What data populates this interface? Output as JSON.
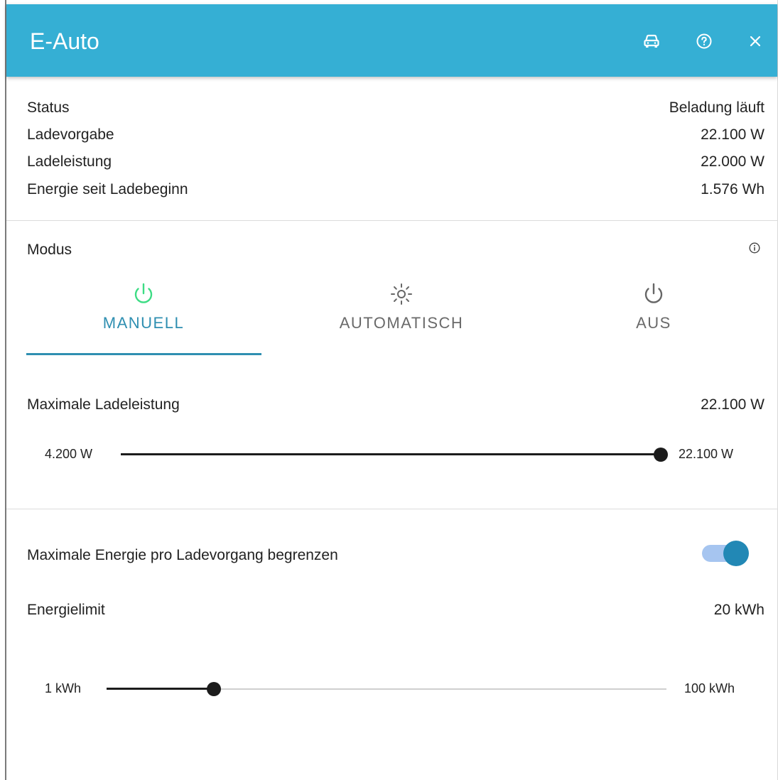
{
  "dialog": {
    "title": "E-Auto",
    "header_icons": [
      "car-icon",
      "help-circle-icon",
      "close-icon"
    ]
  },
  "status_rows": [
    {
      "label": "Status",
      "value": "Beladung läuft"
    },
    {
      "label": "Ladevorgabe",
      "value": "22.100 W"
    },
    {
      "label": "Ladeleistung",
      "value": "22.000 W"
    },
    {
      "label": "Energie seit Ladebeginn",
      "value": "1.576 Wh"
    }
  ],
  "mode": {
    "label": "Modus",
    "tabs": [
      {
        "label": "MANUELL",
        "icon": "power-icon",
        "active": true
      },
      {
        "label": "AUTOMATISCH",
        "icon": "sun-icon",
        "active": false
      },
      {
        "label": "AUS",
        "icon": "power-off-icon",
        "active": false
      }
    ]
  },
  "max_power": {
    "label": "Maximale Ladeleistung",
    "value": "22.100 W",
    "min_label": "4.200 W",
    "max_label": "22.100 W",
    "min": 4200,
    "max": 22100,
    "current": 22100
  },
  "energy_limit": {
    "toggle_label": "Maximale Energie pro Ladevorgang begrenzen",
    "toggle_on": true,
    "label": "Energielimit",
    "value": "20 kWh",
    "min_label": "1 kWh",
    "max_label": "100 kWh",
    "min": 1,
    "max": 100,
    "current": 20
  },
  "colors": {
    "header": "#35afd4",
    "accent": "#2f8fb1",
    "power_green": "#3ddc84",
    "toggle_knob": "#2288b5",
    "toggle_track": "#a6c5f0"
  }
}
